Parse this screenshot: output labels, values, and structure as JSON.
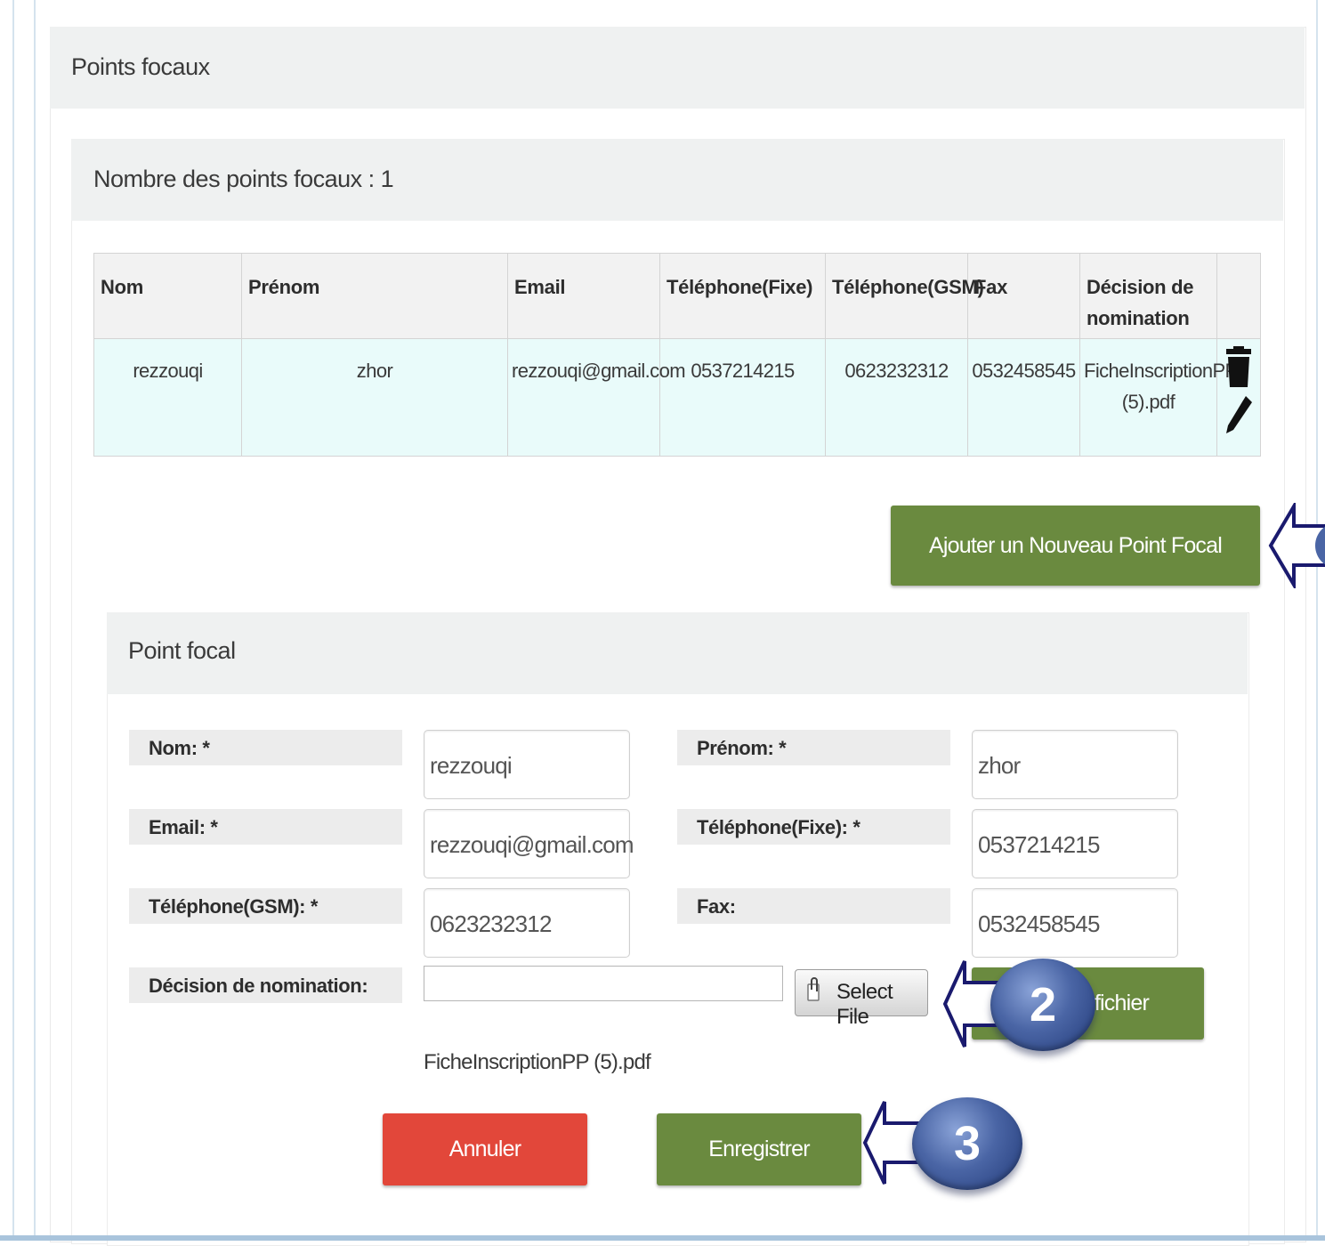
{
  "panel": {
    "title": "Points focaux"
  },
  "summary": {
    "title": "Nombre des points focaux : 1"
  },
  "table": {
    "headers": [
      "Nom",
      "Prénom",
      "Email",
      "Téléphone(Fixe)",
      "Téléphone(GSM)",
      "Fax",
      "Décision de nomination"
    ],
    "rows": [
      {
        "nom": "rezzouqi",
        "prenom": "zhor",
        "email": "rezzouqi@gmail.com",
        "tel_fixe": "0537214215",
        "tel_gsm": "0623232312",
        "fax": "0532458545",
        "decision": "FicheInscriptionPP (5).pdf"
      }
    ]
  },
  "icons": {
    "delete": "trash-icon",
    "edit": "pencil-icon",
    "attach": "paperclip-icon"
  },
  "add_button": {
    "label": "Ajouter un Nouveau Point Focal"
  },
  "form": {
    "title": "Point focal",
    "labels": {
      "nom": "Nom: *",
      "prenom": "Prénom: *",
      "email": "Email: *",
      "tel_fixe": "Téléphone(Fixe): *",
      "tel_gsm": "Téléphone(GSM): *",
      "fax": "Fax:",
      "decision": "Décision de nomination:"
    },
    "values": {
      "nom": "rezzouqi",
      "prenom": "zhor",
      "email": "rezzouqi@gmail.com",
      "tel_fixe": "0537214215",
      "tel_gsm": "0623232312",
      "fax": "0532458545"
    },
    "select_file_label": "Select File",
    "upload_label": "fichier",
    "file_name": "FicheInscriptionPP (5).pdf",
    "cancel_label": "Annuler",
    "save_label": "Enregistrer"
  },
  "badges": {
    "step2": "2",
    "step3": "3"
  },
  "colors": {
    "green": "#6a8a3f",
    "red": "#e2473a",
    "badge_blue": "#4a65a5",
    "arrow_navy": "#1a1a6e",
    "row_bg": "#e9fbfa"
  }
}
